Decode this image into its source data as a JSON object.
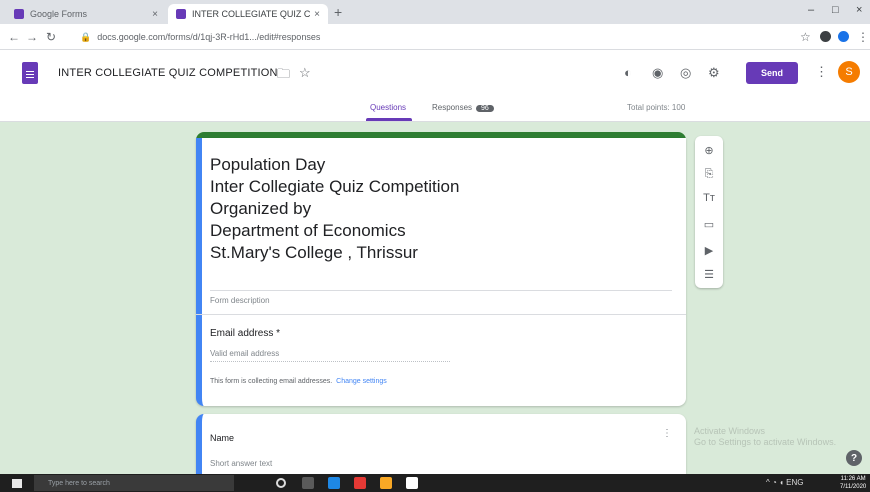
{
  "browser": {
    "tabs": [
      {
        "label": "Google Forms"
      },
      {
        "label": "INTER COLLEGIATE QUIZ COMPE"
      }
    ],
    "url": "docs.google.com/forms/d/1qj-3R-rHd1.../edit#responses",
    "new_tab": "+",
    "minimize": "–",
    "maximize": "□",
    "close": "×"
  },
  "header": {
    "doc_title": "INTER COLLEGIATE QUIZ COMPETITION",
    "send_label": "Send",
    "avatar_letter": "S",
    "accent": "#673ab7"
  },
  "form_tabs": {
    "questions": "Questions",
    "responses": "Responses",
    "responses_count": "96",
    "total_points": "Total points: 100"
  },
  "form": {
    "title_lines": [
      "Population Day",
      "Inter Collegiate Quiz Competition",
      "Organized by",
      "Department of Economics",
      "St.Mary's College , Thrissur"
    ],
    "description_placeholder": "Form description",
    "email_label": "Email address *",
    "email_placeholder": "Valid email address",
    "collecting_note": "This form is collecting email addresses.",
    "change_settings": "Change settings",
    "theme_color": "#2e7d32"
  },
  "question": {
    "title": "Name",
    "answer_placeholder": "Short answer text"
  },
  "sidebar": {
    "icons": [
      "add-question-icon",
      "import-questions-icon",
      "add-title-icon",
      "add-image-icon",
      "add-video-icon",
      "add-section-icon"
    ]
  },
  "watermark": {
    "line1": "Activate Windows",
    "line2": "Go to Settings to activate Windows."
  },
  "taskbar": {
    "search_placeholder": "Type here to search",
    "clock_time": "11:26 AM",
    "clock_date": "7/11/2020",
    "lang": "ENG"
  }
}
